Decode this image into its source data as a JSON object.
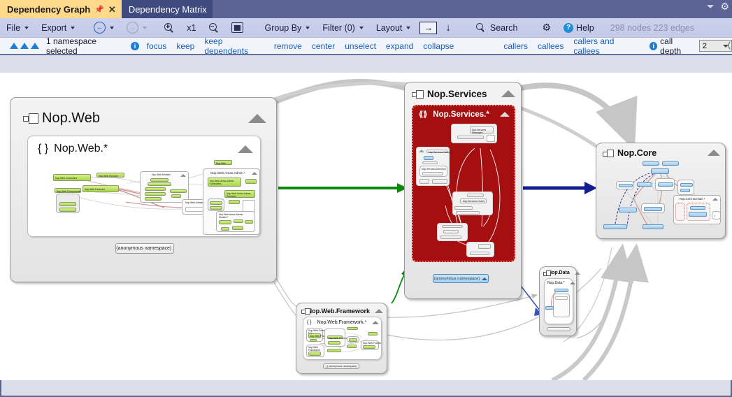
{
  "window": {
    "tabs": [
      {
        "label": "Dependency Graph",
        "active": true,
        "pin": "📌",
        "close": "✕"
      },
      {
        "label": "Dependency Matrix",
        "active": false
      }
    ],
    "controls": {
      "dropdown": "chevron-down-icon",
      "settings": "gear-icon"
    }
  },
  "toolbar": {
    "file": "File",
    "export": "Export",
    "back": "back-icon",
    "forward": "forward-icon",
    "zoom_in": "zoom-in-icon",
    "zoom_level": "x1",
    "zoom_out": "zoom-out-icon",
    "fit": "fit-to-screen-icon",
    "group_by": "Group By",
    "filter": "Filter (0)",
    "layout": "Layout",
    "direction_arrow": "→",
    "down_arrow": "↓",
    "search": "Search",
    "settings": "gear-icon",
    "help": "Help",
    "stats": "298 nodes 223 edges"
  },
  "actionbar": {
    "selection": "1 namespace selected",
    "focus": "focus",
    "keep": "keep",
    "keep_dependents": "keep dependents",
    "remove": "remove",
    "center": "center",
    "unselect": "unselect",
    "expand": "expand",
    "collapse": "collapse",
    "callers": "callers",
    "callees": "callees",
    "callers_and_callees": "callers and callees",
    "call_depth_label": "call depth",
    "call_depth_value": "2"
  },
  "graph": {
    "nodes": [
      {
        "id": "nop-web",
        "title": "Nop.Web",
        "namespace": "Nop.Web.*",
        "anon": "{ } (anonymous namespace)",
        "sub_namespaces": [
          "Nop.Web.Controllers",
          "Nop.Web.Factories",
          "Nop.Web.Models",
          "Nop.Web.Areas.Admin.*",
          "Nop.Web.Areas.Admin.Controllers",
          "Nop.Web.Areas.Admin.Factories",
          "Nop.Web.Areas.Admin.Models.*"
        ],
        "theme": "green"
      },
      {
        "id": "nop-services",
        "title": "Nop.Services",
        "namespace": "Nop.Services.*",
        "anon": "(anonymous namespace)",
        "sub_namespaces": [
          "Nop.Services.Catalog",
          "Nop.Services.Orders",
          "Nop.Services.Messages",
          "Nop.Services.Directory"
        ],
        "theme": "red-selected"
      },
      {
        "id": "nop-core",
        "title": "Nop.Core",
        "namespace": "Nop.Core.Domain.*",
        "theme": "blue"
      },
      {
        "id": "nop-web-framework",
        "title": "Nop.Web.Framework",
        "namespace": "Nop.Web.Framework.*",
        "theme": "green"
      },
      {
        "id": "nop-data",
        "title": "Nop.Data",
        "namespace": "Nop.Data.*",
        "theme": "blue"
      }
    ],
    "edges": [
      {
        "from": "nop-web",
        "to": "nop-services",
        "color": "#0a8a0a",
        "style": "thick"
      },
      {
        "from": "nop-services",
        "to": "nop-core",
        "color": "#131f8e",
        "style": "thick"
      },
      {
        "from": "nop-web-framework",
        "to": "nop-services",
        "color": "#0a8a0a",
        "style": "thin"
      },
      {
        "from": "nop-services",
        "to": "nop-data",
        "color": "#3a56b5",
        "style": "thin"
      }
    ],
    "colors": {
      "edge_green": "#0a8a0a",
      "edge_navy": "#131f8e",
      "selected_fill": "#a60f0f",
      "selected_border": "#ff6b6b"
    }
  }
}
